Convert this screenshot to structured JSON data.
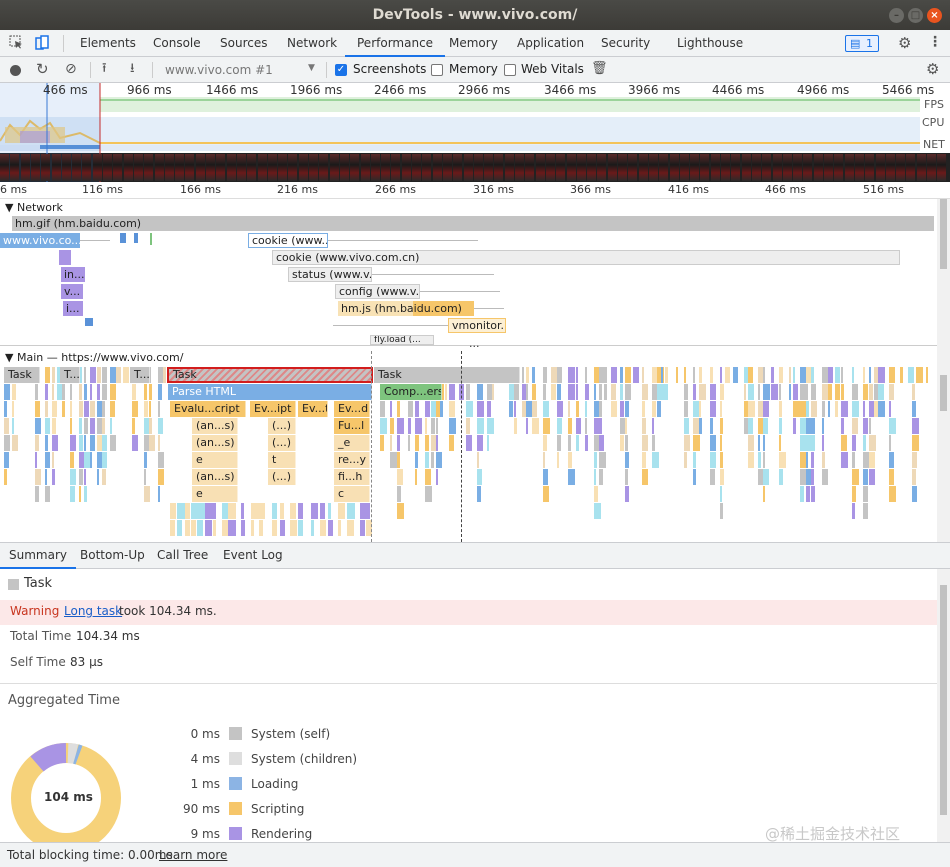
{
  "window": {
    "title": "DevTools - www.vivo.com/"
  },
  "tabs": [
    "Elements",
    "Console",
    "Sources",
    "Network",
    "Performance",
    "Memory",
    "Application",
    "Security",
    "Lighthouse"
  ],
  "issues_count": "1",
  "perf_toolbar": {
    "profile_select": "www.vivo.com #1",
    "screenshots": "Screenshots",
    "memory": "Memory",
    "web_vitals": "Web Vitals"
  },
  "overview": {
    "ticks": [
      "466 ms",
      "966 ms",
      "1466 ms",
      "1966 ms",
      "2466 ms",
      "2966 ms",
      "3466 ms",
      "3966 ms",
      "4466 ms",
      "4966 ms",
      "5466 ms"
    ],
    "labels": {
      "fps": "FPS",
      "cpu": "CPU",
      "net": "NET"
    }
  },
  "ruler": [
    "6 ms",
    "116 ms",
    "166 ms",
    "216 ms",
    "266 ms",
    "316 ms",
    "366 ms",
    "416 ms",
    "466 ms",
    "516 ms"
  ],
  "network": {
    "title": "Network",
    "rows": [
      {
        "label": "hm.gif (hm.baidu.com)"
      },
      {
        "label": "www.vivo.co..."
      },
      {
        "label": "cookie (www..."
      },
      {
        "label": "cookie (www.vivo.com.cn)"
      },
      {
        "label": "status (www.v..."
      },
      {
        "label": "config (www.v..."
      },
      {
        "label": "hm.js (hm.baidu.com)"
      },
      {
        "label": "vmonitor..."
      },
      {
        "label": "in..."
      },
      {
        "label": "v..."
      },
      {
        "label": "i..."
      },
      {
        "label": "fly.load (..."
      }
    ]
  },
  "main": {
    "title": "Main — https://www.vivo.com/",
    "tasks": [
      "Task",
      "T...",
      "T...",
      "Task",
      "Task"
    ],
    "parse_html": "Parse HTML",
    "compile": "Comp...ers",
    "eval": [
      "Evalu...cript",
      "Ev...ipt",
      "Ev...t",
      "Ev...d"
    ],
    "calls": [
      "(an...s)",
      "(...)",
      "Fu...l",
      "(an...s)",
      "(...)",
      "_e",
      "e",
      "t",
      "re...y",
      "(an...s)",
      "(...)",
      "fi...h",
      "e",
      "c"
    ],
    "ellipsis": "..."
  },
  "bottom": {
    "tabs": [
      "Summary",
      "Bottom-Up",
      "Call Tree",
      "Event Log"
    ],
    "task_title": "Task",
    "warning_label": "Warning",
    "warning_link": "Long task",
    "warning_text": "took 104.34 ms.",
    "total_time_label": "Total Time",
    "total_time": "104.34 ms",
    "self_time_label": "Self Time",
    "self_time": "83 μs",
    "aggregated": "Aggregated Time",
    "pie_center": "104 ms",
    "legend": [
      {
        "ms": "0 ms",
        "name": "System (self)",
        "color": "#c4c4c4"
      },
      {
        "ms": "4 ms",
        "name": "System (children)",
        "color": "#dedede"
      },
      {
        "ms": "1 ms",
        "name": "Loading",
        "color": "#8cb4e4"
      },
      {
        "ms": "90 ms",
        "name": "Scripting",
        "color": "#f6c66a"
      },
      {
        "ms": "9 ms",
        "name": "Rendering",
        "color": "#a994e4"
      }
    ],
    "footer_text": "Total blocking time: 0.00ms",
    "footer_link": "Learn more",
    "watermark": "@稀土掘金技术社区"
  }
}
